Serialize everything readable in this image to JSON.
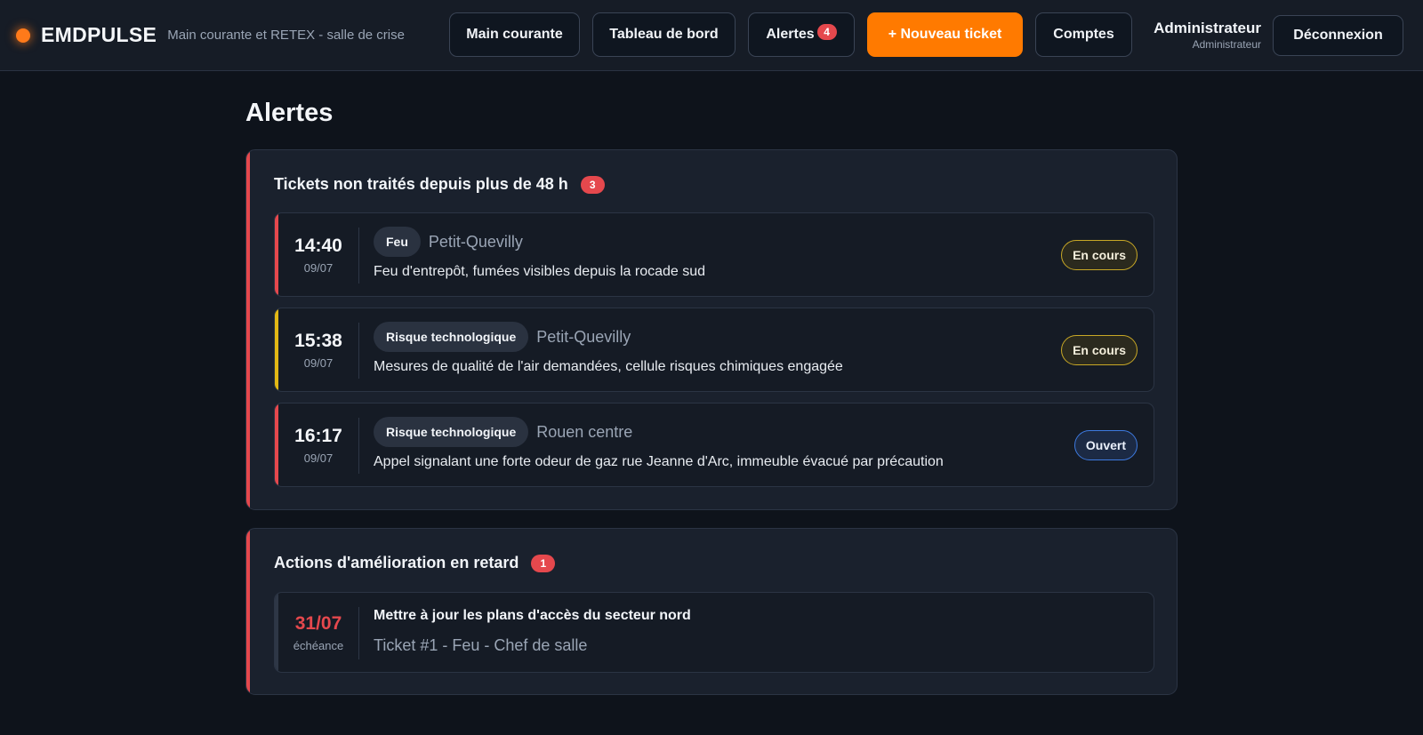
{
  "app": {
    "name": "EMDPULSE",
    "subtitle": "Main courante et RETEX - salle de crise"
  },
  "nav": {
    "main_courante": "Main courante",
    "tableau_de_bord": "Tableau de bord",
    "alertes": "Alertes",
    "alertes_count": "4",
    "nouveau_ticket": "+ Nouveau ticket",
    "comptes": "Comptes"
  },
  "user": {
    "name": "Administrateur",
    "role": "Administrateur",
    "logout": "Déconnexion"
  },
  "page": {
    "title": "Alertes"
  },
  "colors": {
    "accent": "#ff7a00",
    "danger": "#e5484d",
    "warning": "#e2b814",
    "info": "#3d7ae0",
    "background": "#0e131b",
    "card": "#1a212d"
  },
  "tickets_section": {
    "title": "Tickets non traités depuis plus de 48 h",
    "count": "3",
    "items": [
      {
        "time": "14:40",
        "date": "09/07",
        "category": "Feu",
        "location": "Petit-Quevilly",
        "description": "Feu d'entrepôt, fumées visibles depuis la rocade sud",
        "status": "En cours",
        "priority_color": "#e5484d"
      },
      {
        "time": "15:38",
        "date": "09/07",
        "category": "Risque technologique",
        "location": "Petit-Quevilly",
        "description": "Mesures de qualité de l'air demandées, cellule risques chimiques engagée",
        "status": "En cours",
        "priority_color": "#e2b814"
      },
      {
        "time": "16:17",
        "date": "09/07",
        "category": "Risque technologique",
        "location": "Rouen centre",
        "description": "Appel signalant une forte odeur de gaz rue Jeanne d'Arc, immeuble évacué par précaution",
        "status": "Ouvert",
        "priority_color": "#e5484d"
      }
    ]
  },
  "actions_section": {
    "title": "Actions d'amélioration en retard",
    "count": "1",
    "items": [
      {
        "due_date": "31/07",
        "due_label": "échéance",
        "title": "Mettre à jour les plans d'accès du secteur nord",
        "meta": "Ticket #1 - Feu - Chef de salle"
      }
    ]
  }
}
